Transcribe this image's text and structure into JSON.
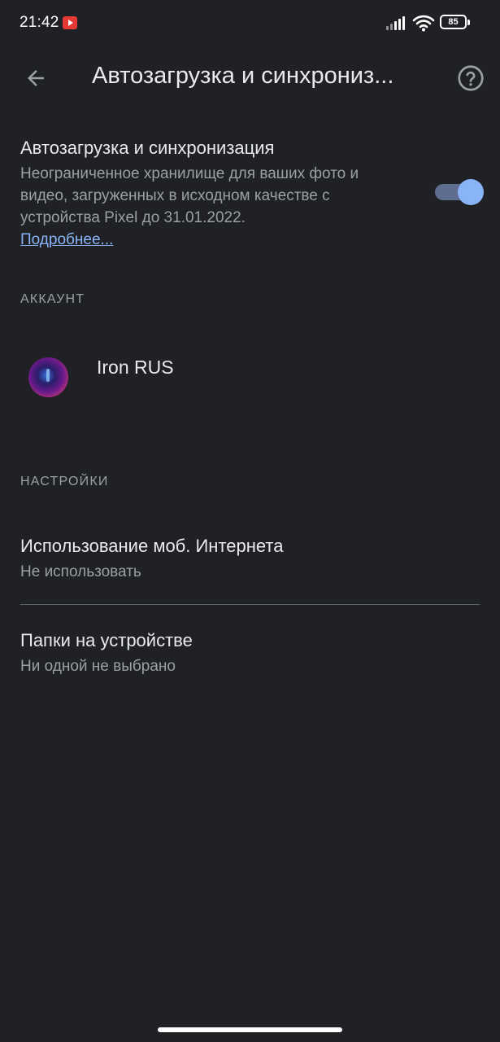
{
  "status_bar": {
    "time": "21:42",
    "battery": "85",
    "icons": [
      "youtube-notification-icon",
      "signal-icon",
      "wifi-icon",
      "battery-icon"
    ]
  },
  "app_bar": {
    "title": "Автозагрузка и синхрониз...",
    "back_icon": "arrow-back-icon",
    "help_icon": "help-circle-icon"
  },
  "backup": {
    "title": "Автозагрузка и синхронизация",
    "description": "Неограниченное хранилище для ваших фото и видео, загруженных в исходном качестве с устройства Pixel до 31.01.2022.",
    "learn_more": "Подробнее...",
    "toggle_on": true
  },
  "account_section": {
    "header": "АККАУНТ",
    "name": "Iron RUS"
  },
  "settings_section": {
    "header": "НАСТРОЙКИ",
    "items": [
      {
        "title": "Использование моб. Интернета",
        "subtitle": "Не использовать"
      },
      {
        "title": "Папки на устройстве",
        "subtitle": "Ни одной не выбрано"
      }
    ]
  },
  "colors": {
    "background": "#202124",
    "primary_text": "#e8eaed",
    "secondary_text": "#9aa0a6",
    "accent": "#8ab4f8",
    "toggle_track": "#5f6d91"
  }
}
